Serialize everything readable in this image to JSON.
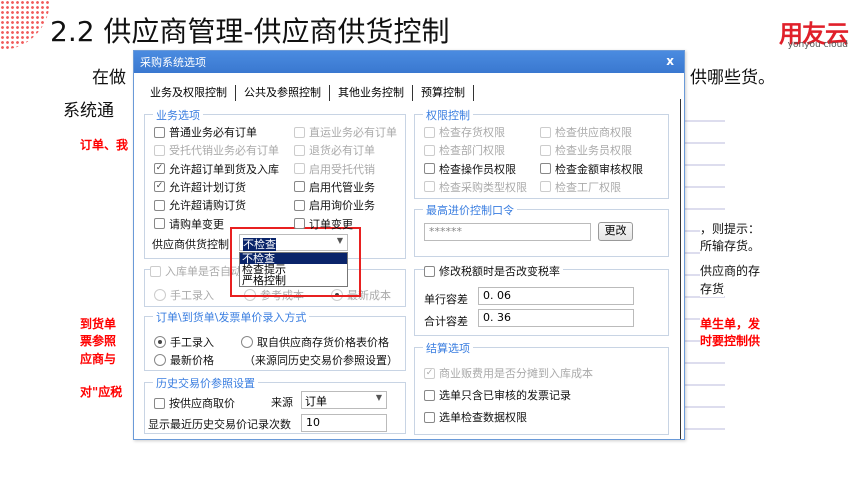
{
  "slide": {
    "title": "2.2 供应商管理-供应商供货控制",
    "logo": "用友云",
    "logo_sub": "yonyou cloud",
    "line1_left": "在做",
    "line1_right": "供哪些货。",
    "line2_left": "系统通",
    "red1": "订单、我",
    "red2a": "到货单",
    "red2b": "票参照",
    "red2c": "应商与",
    "red3": "对\"应税",
    "right1": "，则提示：",
    "right2": "所输存货。",
    "right3": "供应商的存",
    "right4": "存货",
    "right_red1": "单生单，发",
    "right_red2": "时要控制供"
  },
  "dialog": {
    "title": "采购系统选项",
    "close": "x",
    "tabs": [
      "业务及权限控制",
      "公共及参照控制",
      "其他业务控制",
      "预算控制"
    ],
    "business": {
      "label": "业务选项",
      "items": [
        {
          "label": "普通业务必有订单",
          "checked": false,
          "disabled": false
        },
        {
          "label": "直运业务必有订单",
          "checked": false,
          "disabled": true
        },
        {
          "label": "受托代销业务必有订单",
          "checked": false,
          "disabled": true
        },
        {
          "label": "退货必有订单",
          "checked": false,
          "disabled": true
        },
        {
          "label": "允许超订单到货及入库",
          "checked": true,
          "disabled": false
        },
        {
          "label": "启用受托代销",
          "checked": false,
          "disabled": true
        },
        {
          "label": "允许超计划订货",
          "checked": true,
          "disabled": false
        },
        {
          "label": "启用代管业务",
          "checked": false,
          "disabled": false
        },
        {
          "label": "允许超请购订货",
          "checked": false,
          "disabled": false
        },
        {
          "label": "启用询价业务",
          "checked": false,
          "disabled": false
        },
        {
          "label": "请购单变更",
          "checked": false,
          "disabled": false
        },
        {
          "label": "订单变更",
          "checked": false,
          "disabled": false
        }
      ],
      "supply_control_label": "供应商供货控制",
      "supply_control_value": "不检查",
      "supply_control_options": [
        "不检查",
        "检查提示",
        "严格控制"
      ]
    },
    "inbound": {
      "label": "入库单是否自动",
      "radios": [
        {
          "label": "手工录入",
          "on": false
        },
        {
          "label": "参考成本",
          "on": false
        },
        {
          "label": "最新成本",
          "on": true
        }
      ]
    },
    "price_entry": {
      "label": "订单\\到货单\\发票单价录入方式",
      "radios": [
        {
          "label": "手工录入",
          "on": true
        },
        {
          "label": "取自供应商存货价格表价格",
          "on": false
        },
        {
          "label": "最新价格",
          "on": false
        }
      ],
      "note": "（来源同历史交易价参照设置）"
    },
    "history": {
      "label": "历史交易价参照设置",
      "by_supplier": "按供应商取价",
      "source_label": "来源",
      "source_value": "订单",
      "count_label": "显示最近历史交易价记录次数",
      "count_value": "10"
    },
    "permission": {
      "label": "权限控制",
      "items": [
        {
          "label": "检查存货权限",
          "disabled": true
        },
        {
          "label": "检查供应商权限",
          "disabled": true
        },
        {
          "label": "检查部门权限",
          "disabled": true
        },
        {
          "label": "检查业务员权限",
          "disabled": true
        },
        {
          "label": "检查操作员权限",
          "disabled": false
        },
        {
          "label": "检查金额审核权限",
          "disabled": false
        },
        {
          "label": "检查采购类型权限",
          "disabled": true
        },
        {
          "label": "检查工厂权限",
          "disabled": true
        }
      ]
    },
    "password": {
      "label": "最高进价控制口令",
      "value": "******",
      "change": "更改"
    },
    "tax": {
      "label": "修改税额时是否改变税率",
      "row_label": "单行容差",
      "row_value": "0. 06",
      "total_label": "合计容差",
      "total_value": "0. 36"
    },
    "settle": {
      "label": "结算选项",
      "items": [
        {
          "label": "商业贩费用是否分摊到入库成本",
          "checked": true,
          "disabled": true
        },
        {
          "label": "选单只含已审核的发票记录",
          "checked": false,
          "disabled": false
        },
        {
          "label": "选单检查数据权限",
          "checked": false,
          "disabled": false
        }
      ]
    }
  }
}
